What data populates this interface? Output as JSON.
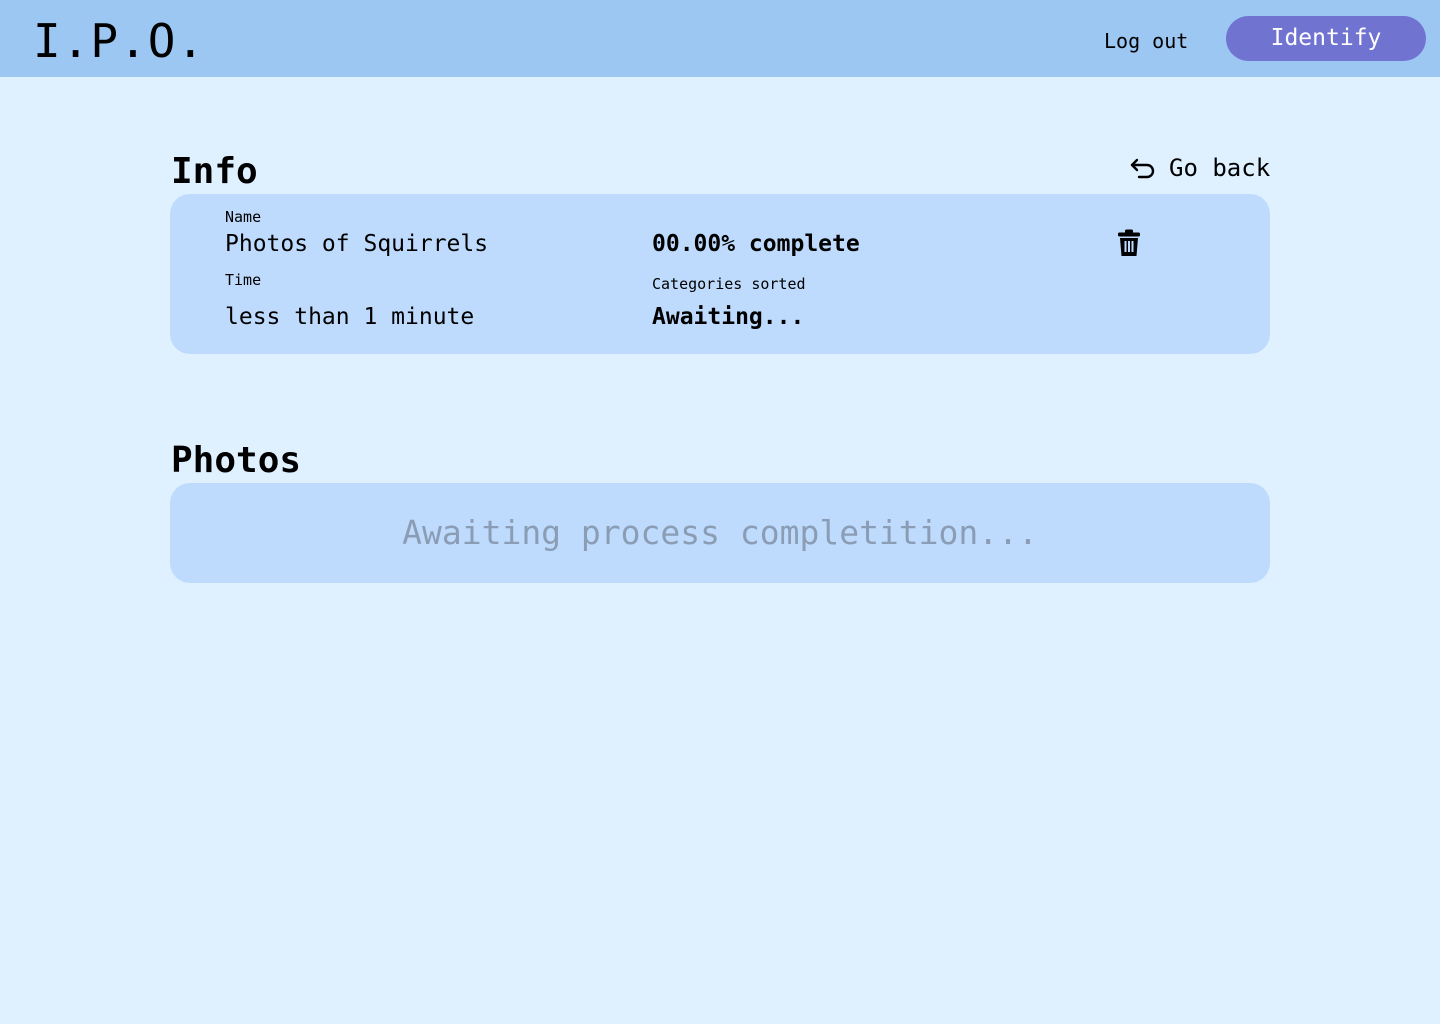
{
  "header": {
    "logo": "I.P.O.",
    "logout_label": "Log out",
    "identify_label": "Identify"
  },
  "info": {
    "title": "Info",
    "go_back_label": "Go back",
    "name_label": "Name",
    "name_value": "Photos of Squirrels",
    "progress": "00.00% complete",
    "time_label": "Time",
    "time_value": "less than 1 minute",
    "categories_label": "Categories sorted",
    "categories_value": "Awaiting..."
  },
  "photos": {
    "title": "Photos",
    "status": "Awaiting process completition..."
  },
  "icons": {
    "go_back": "undo-arrow-icon",
    "delete": "trash-icon"
  },
  "colors": {
    "background": "#dff0ff",
    "header": "#9cc7f2",
    "card": "#bedbfd",
    "accent": "#7173d1",
    "muted_text": "#8a9db5"
  }
}
